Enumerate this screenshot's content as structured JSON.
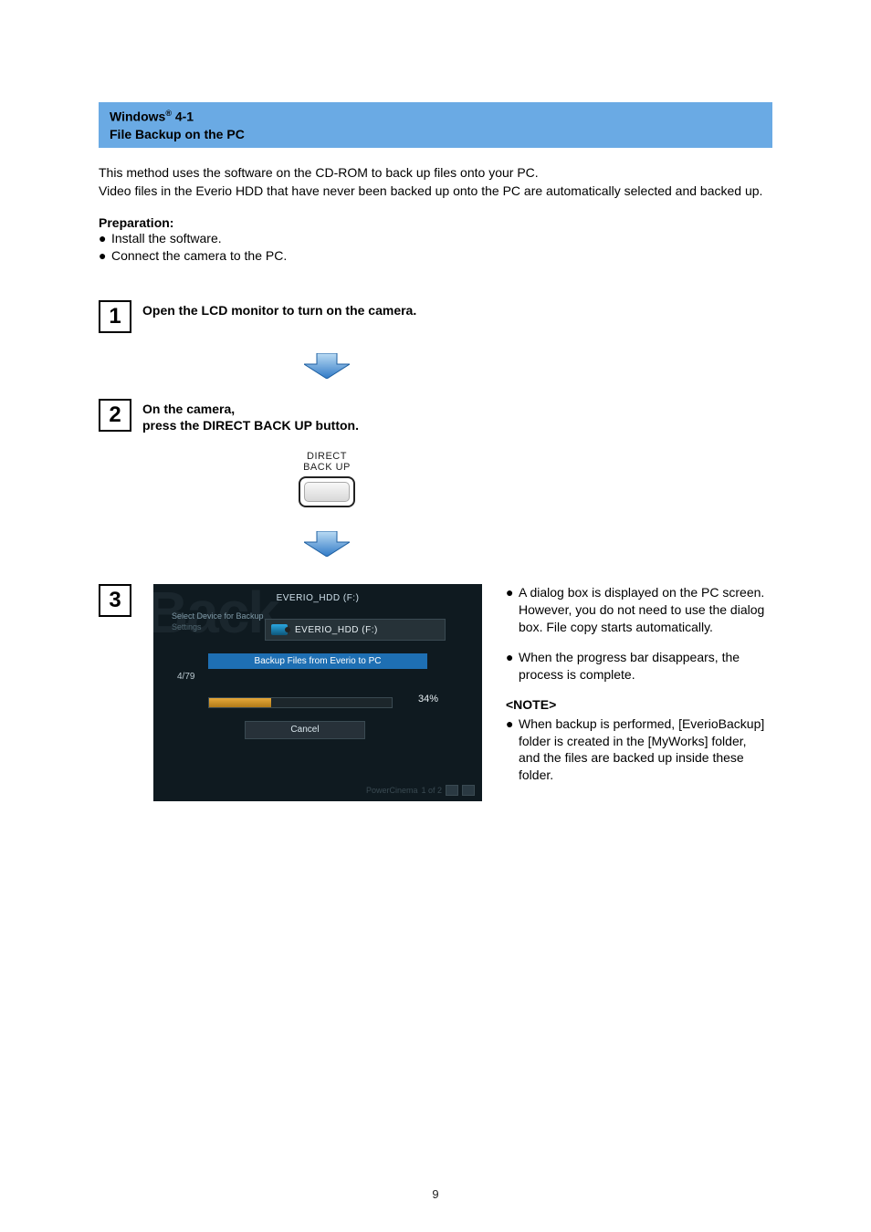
{
  "header": {
    "line1_pre": "Windows",
    "line1_sup": "®",
    "line1_post": " 4-1",
    "line2": "File Backup on the PC"
  },
  "intro": {
    "p1": "This method uses the software on the CD-ROM to back up files onto your PC.",
    "p2": "Video files in the Everio HDD that have never been backed up onto the PC are automatically selected and backed up."
  },
  "prep": {
    "title": "Preparation:",
    "items": [
      "Install the software.",
      "Connect the camera to the PC."
    ]
  },
  "steps": {
    "s1": {
      "num": "1",
      "text": "Open the LCD monitor to turn on the camera."
    },
    "s2": {
      "num": "2",
      "line1": "On the camera,",
      "line2": "press the DIRECT BACK UP button."
    },
    "s3": {
      "num": "3"
    }
  },
  "direct_button": {
    "line1": "DIRECT",
    "line2": "BACK UP"
  },
  "screenshot": {
    "bgword": "Back",
    "title_top": "EVERIO_HDD (F:)",
    "label_select": "Select Device for Backup",
    "label_settings": "Settings",
    "dropdown_text": "EVERIO_HDD (F:)",
    "blue_bar": "Backup Files from Everio to PC",
    "count": "4/79",
    "progress_pct": 34,
    "progress_label": "34%",
    "cancel": "Cancel",
    "brand_text": "PowerCinema",
    "brand_page": "1 of 2"
  },
  "right": {
    "b1": "A dialog box is displayed on the PC screen. However, you do not need to use the dialog box. File copy starts automatically.",
    "b2": "When the progress bar disappears, the process is complete.",
    "note_head": "<NOTE>",
    "note_body": "When backup is performed, [EverioBackup] folder is created in the [MyWorks] folder, and the files are backed up inside these folder."
  },
  "page_number": "9"
}
